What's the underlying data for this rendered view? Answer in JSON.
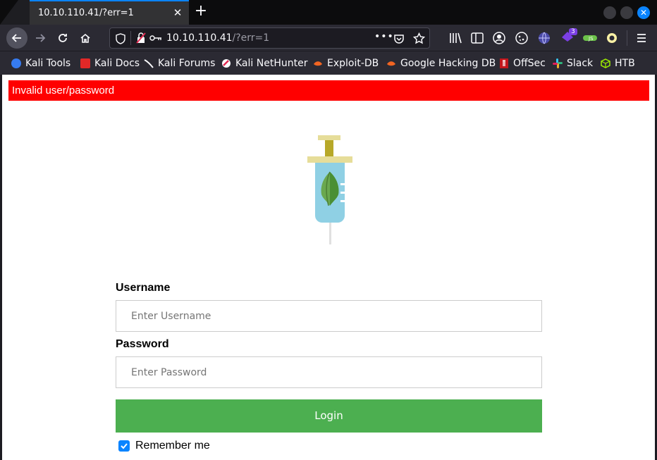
{
  "browser": {
    "tab_title": "10.10.110.41/?err=1",
    "tab_close_glyph": "✕",
    "new_tab_glyph": "+",
    "url_host": "10.10.110.41",
    "url_path": "/?err=1",
    "accent_color": "#0a84ff",
    "extension_badge": "3"
  },
  "bookmarks": [
    {
      "label": "Kali Tools",
      "icon": "kali-tools-icon"
    },
    {
      "label": "Kali Docs",
      "icon": "kali-docs-icon"
    },
    {
      "label": "Kali Forums",
      "icon": "kali-forums-icon"
    },
    {
      "label": "Kali NetHunter",
      "icon": "nethunter-icon"
    },
    {
      "label": "Exploit-DB",
      "icon": "exploit-db-icon"
    },
    {
      "label": "Google Hacking DB",
      "icon": "ghdb-icon"
    },
    {
      "label": "OffSec",
      "icon": "offsec-icon"
    },
    {
      "label": "Slack",
      "icon": "slack-icon"
    },
    {
      "label": "HTB",
      "icon": "htb-icon"
    }
  ],
  "page": {
    "error_message": "Invalid user/password",
    "error_color": "#ff0000",
    "logo_icon": "syringe-leaf-logo",
    "username_label": "Username",
    "username_placeholder": "Enter Username",
    "password_label": "Password",
    "password_placeholder": "Enter Password",
    "login_label": "Login",
    "login_color": "#4caf50",
    "remember_label": "Remember me",
    "remember_checked": true
  }
}
